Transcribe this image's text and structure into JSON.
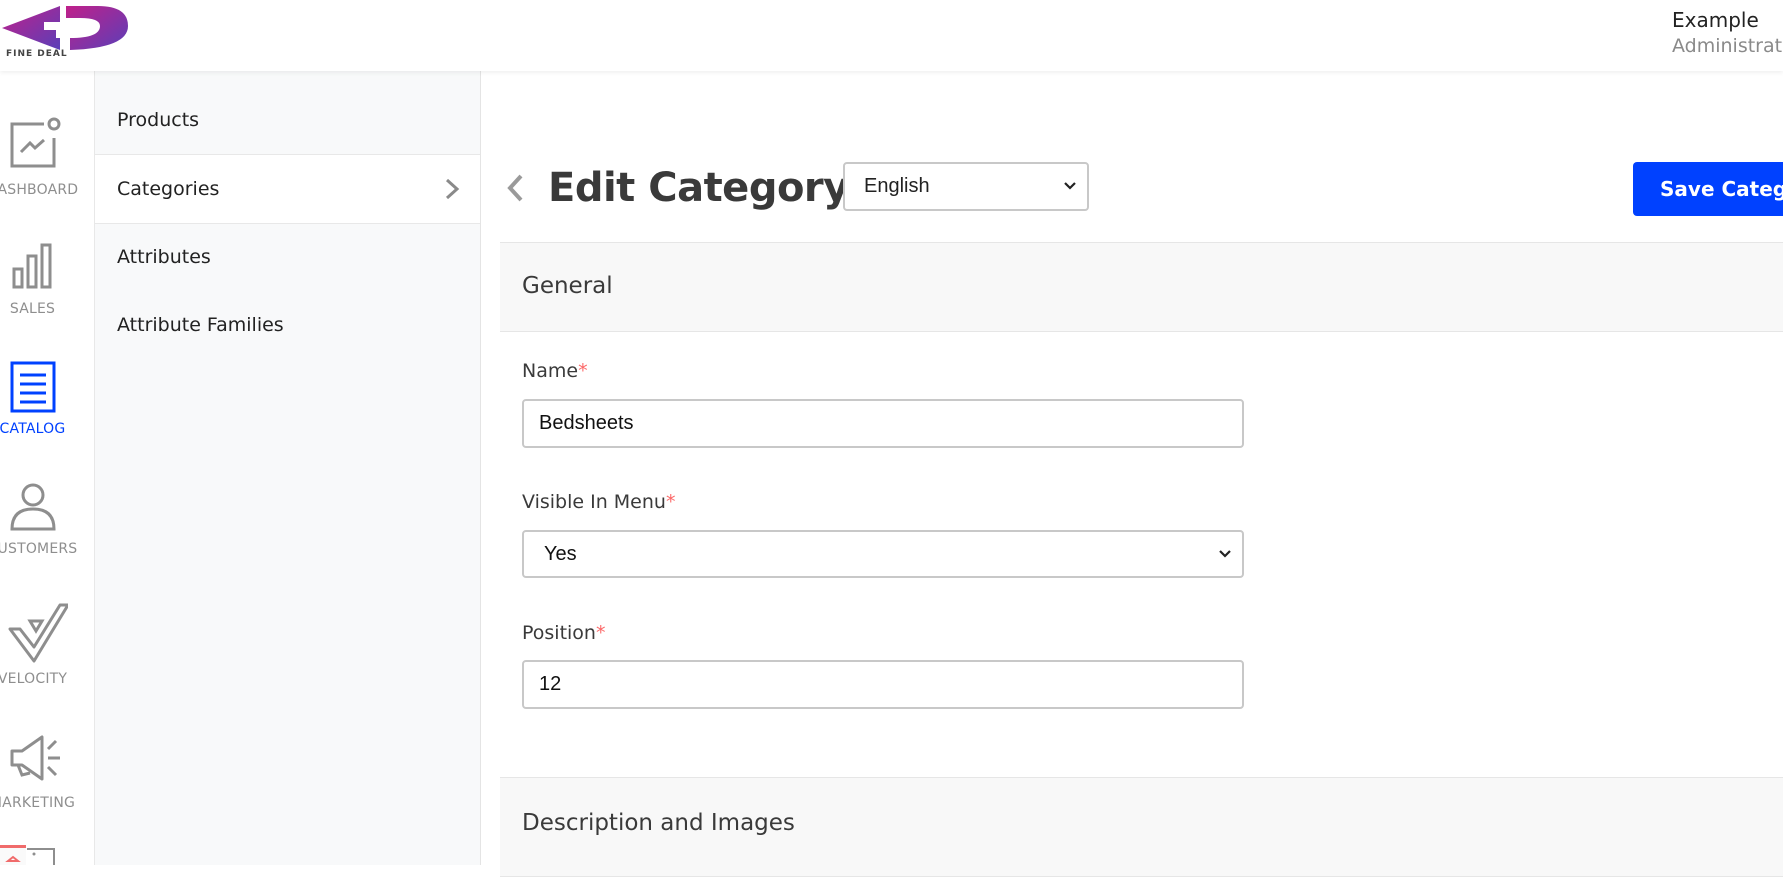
{
  "header": {
    "logo_text": "FINE DEAL",
    "user_name": "Example",
    "user_role": "Administrator"
  },
  "rail": {
    "items": [
      {
        "label": "DASHBOARD",
        "icon": "dashboard-icon",
        "active": false
      },
      {
        "label": "SALES",
        "icon": "bar-chart-icon",
        "active": false
      },
      {
        "label": "CATALOG",
        "icon": "catalog-list-icon",
        "active": true
      },
      {
        "label": "CUSTOMERS",
        "icon": "person-icon",
        "active": false
      },
      {
        "label": "VELOCITY",
        "icon": "velocity-check-icon",
        "active": false
      },
      {
        "label": "MARKETING",
        "icon": "megaphone-icon",
        "active": false
      }
    ],
    "active_color": "#0041ff"
  },
  "subnav": {
    "items": [
      {
        "label": "Products",
        "active": false
      },
      {
        "label": "Categories",
        "active": true
      },
      {
        "label": "Attributes",
        "active": false
      },
      {
        "label": "Attribute Families",
        "active": false
      }
    ]
  },
  "page": {
    "title": "Edit Category",
    "locale_value": "English",
    "save_label": "Save Category",
    "save_color": "#0041ff"
  },
  "general": {
    "title": "General",
    "required_mark": "*",
    "name": {
      "label": "Name",
      "value": "Bedsheets"
    },
    "visible_in_menu": {
      "label": "Visible In Menu",
      "value": "Yes"
    },
    "position": {
      "label": "Position",
      "value": "12"
    }
  },
  "description_section": {
    "title": "Description and Images"
  }
}
